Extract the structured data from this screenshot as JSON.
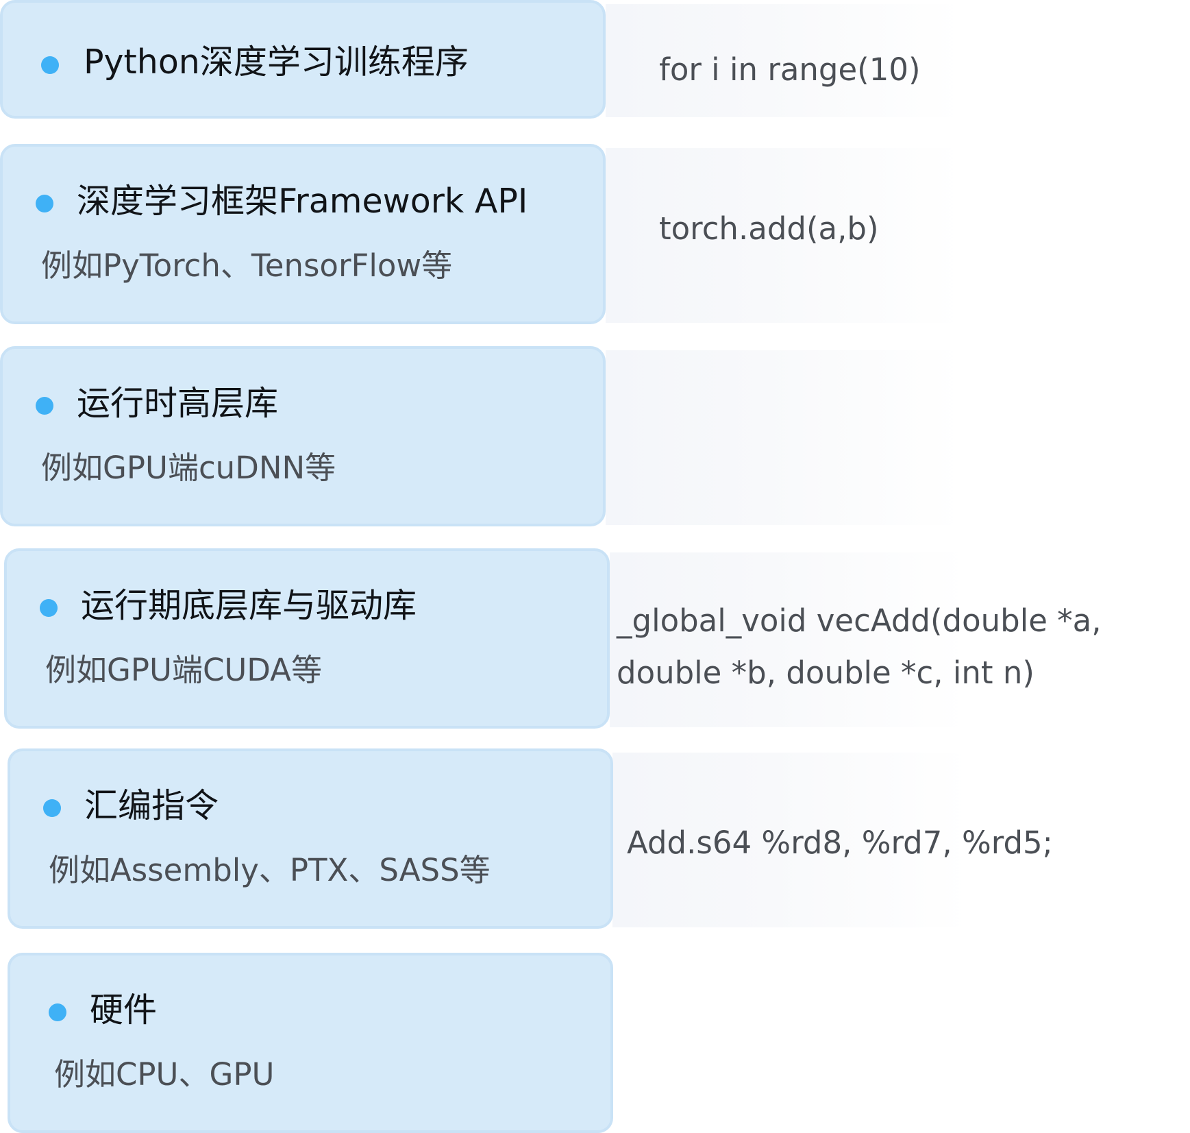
{
  "layers": [
    {
      "title": "Python深度学习训练程序",
      "subtitle": "",
      "code": [
        "for i in range(10)"
      ]
    },
    {
      "title": "深度学习框架Framework API",
      "subtitle": "例如PyTorch、TensorFlow等",
      "code": [
        "torch.add(a,b)"
      ]
    },
    {
      "title": "运行时高层库",
      "subtitle": "例如GPU端cuDNN等",
      "code": []
    },
    {
      "title": "运行期底层库与驱动库",
      "subtitle": "例如GPU端CUDA等",
      "code": [
        "_global_void vecAdd(double *a,",
        "double *b, double *c, int n)"
      ]
    },
    {
      "title": "汇编指令",
      "subtitle": "例如Assembly、PTX、SASS等",
      "code": [
        "Add.s64 %rd8, %rd7, %rd5;"
      ]
    },
    {
      "title": "硬件",
      "subtitle": "例如CPU、GPU",
      "code": []
    }
  ],
  "colors": {
    "card_fill": "#d6eaf9",
    "card_border": "#c9e2f6",
    "bullet": "#3fb1f6",
    "title_text": "#111418",
    "body_text": "#4b4f55"
  }
}
